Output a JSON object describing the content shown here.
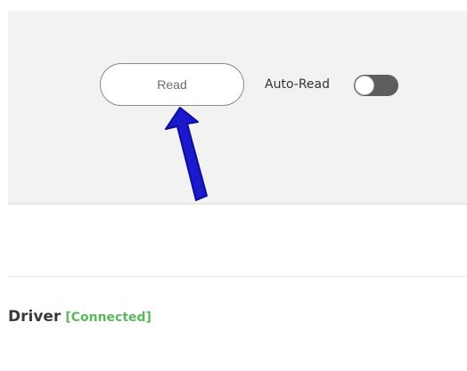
{
  "controls": {
    "read_button_label": "Read",
    "auto_read_label": "Auto-Read",
    "auto_read_enabled": false
  },
  "driver": {
    "title": "Driver",
    "status": "[Connected]"
  },
  "colors": {
    "panel_background": "#f2f2f2",
    "toggle_off": "#5d5d5d",
    "status_connected": "#5cb85c",
    "annotation_arrow": "#1a1acc"
  },
  "icons": {
    "annotation": "arrow-up-icon"
  }
}
